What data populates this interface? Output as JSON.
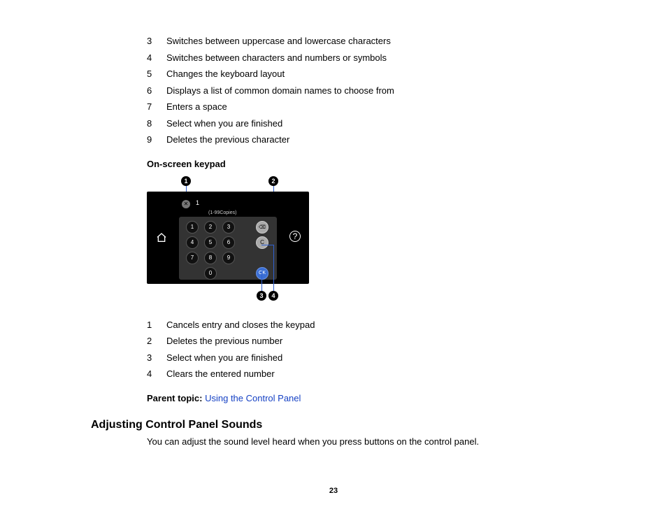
{
  "list1": [
    {
      "n": "3",
      "t": "Switches between uppercase and lowercase characters"
    },
    {
      "n": "4",
      "t": "Switches between characters and numbers or symbols"
    },
    {
      "n": "5",
      "t": "Changes the keyboard layout"
    },
    {
      "n": "6",
      "t": "Displays a list of common domain names to choose from"
    },
    {
      "n": "7",
      "t": "Enters a space"
    },
    {
      "n": "8",
      "t": "Select when you are finished"
    },
    {
      "n": "9",
      "t": "Deletes the previous character"
    }
  ],
  "subhead1": "On-screen keypad",
  "callouts_top": {
    "c1": "1",
    "c2": "2"
  },
  "keypad": {
    "value": "1",
    "range": "(1-99Copies)",
    "keys": [
      "1",
      "2",
      "3",
      "4",
      "5",
      "6",
      "7",
      "8",
      "9",
      "0"
    ],
    "del": "⌫",
    "clear": "C",
    "ok": "OK"
  },
  "callouts_bottom": {
    "c3": "3",
    "c4": "4"
  },
  "list2": [
    {
      "n": "1",
      "t": "Cancels entry and closes the keypad"
    },
    {
      "n": "2",
      "t": "Deletes the previous number"
    },
    {
      "n": "3",
      "t": "Select when you are finished"
    },
    {
      "n": "4",
      "t": "Clears the entered number"
    }
  ],
  "parent": {
    "label": "Parent topic:",
    "link": "Using the Control Panel"
  },
  "section_heading": "Adjusting Control Panel Sounds",
  "section_body": "You can adjust the sound level heard when you press buttons on the control panel.",
  "page_number": "23"
}
